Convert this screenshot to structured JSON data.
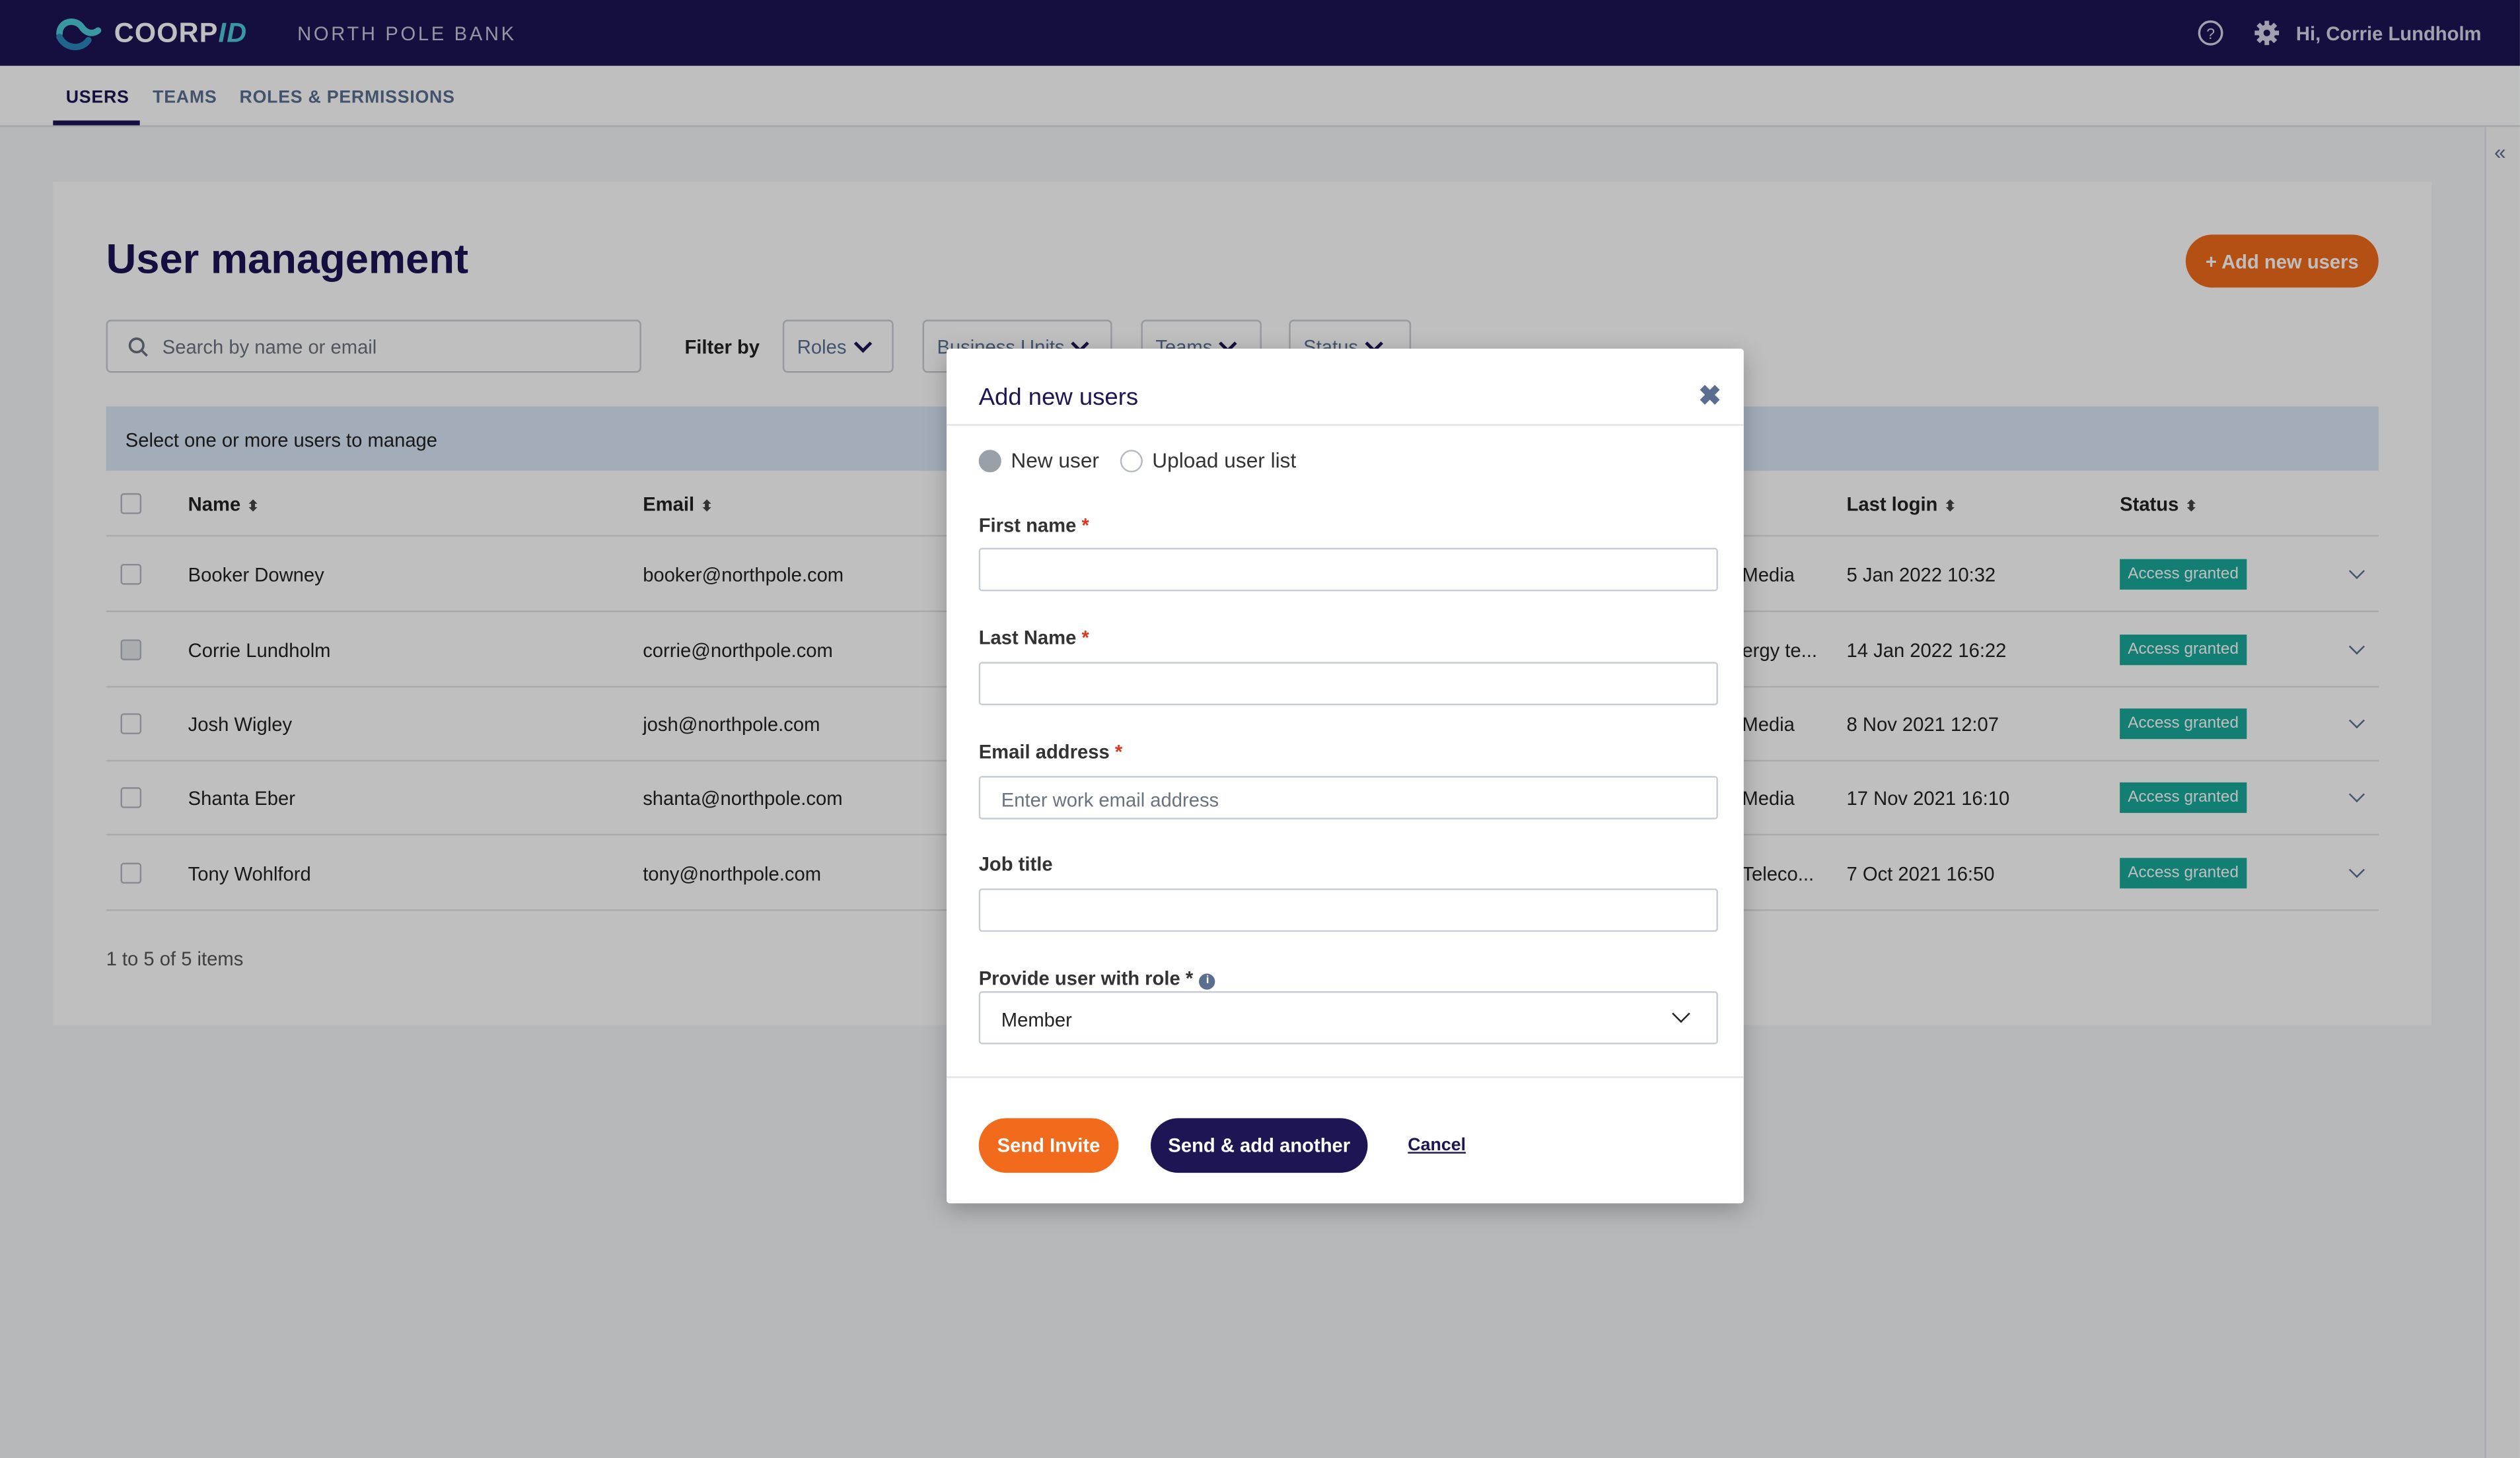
{
  "header": {
    "logo_main": "COORP",
    "logo_accent": "ID",
    "org_name": "NORTH POLE BANK",
    "greeting": "Hi, Corrie Lundholm"
  },
  "tabs": [
    {
      "label": "USERS",
      "active": true
    },
    {
      "label": "TEAMS",
      "active": false
    },
    {
      "label": "ROLES & PERMISSIONS",
      "active": false
    }
  ],
  "page": {
    "title": "User management",
    "add_button": "+ Add new users",
    "search_placeholder": "Search by name or email",
    "filter_label": "Filter by",
    "filters": [
      "Roles",
      "Business Units",
      "Teams",
      "Status"
    ],
    "select_hint": "Select one or more users to manage",
    "columns": {
      "name": "Name",
      "email": "Email",
      "last_login": "Last login",
      "status": "Status"
    },
    "pager": "1 to 5 of 5 items"
  },
  "users": [
    {
      "name": "Booker Downey",
      "email": "booker@northpole.com",
      "unit": "Media",
      "last_login": "5 Jan 2022 10:32",
      "status": "Access granted"
    },
    {
      "name": "Corrie Lundholm",
      "email": "corrie@northpole.com",
      "unit": "ergy te...",
      "last_login": "14 Jan 2022 16:22",
      "status": "Access granted"
    },
    {
      "name": "Josh Wigley",
      "email": "josh@northpole.com",
      "unit": "Media",
      "last_login": "8 Nov 2021 12:07",
      "status": "Access granted"
    },
    {
      "name": "Shanta Eber",
      "email": "shanta@northpole.com",
      "unit": "Media",
      "last_login": "17 Nov 2021 16:10",
      "status": "Access granted"
    },
    {
      "name": "Tony Wohlford",
      "email": "tony@northpole.com",
      "unit": "Teleco...",
      "last_login": "7 Oct 2021 16:50",
      "status": "Access granted"
    }
  ],
  "modal": {
    "title": "Add new users",
    "radio_new": "New user",
    "radio_upload": "Upload user list",
    "first_name_label": "First name",
    "last_name_label": "Last Name",
    "email_label": "Email address",
    "email_placeholder": "Enter work email address",
    "job_title_label": "Job title",
    "role_label": "Provide user with role *",
    "role_value": "Member",
    "send_invite": "Send Invite",
    "send_add_another": "Send & add another",
    "cancel": "Cancel"
  },
  "colors": {
    "brand_navy": "#1d1554",
    "accent_orange": "#f26b1d",
    "status_green": "#1aa89a",
    "logo_teal": "#4ccad8"
  }
}
